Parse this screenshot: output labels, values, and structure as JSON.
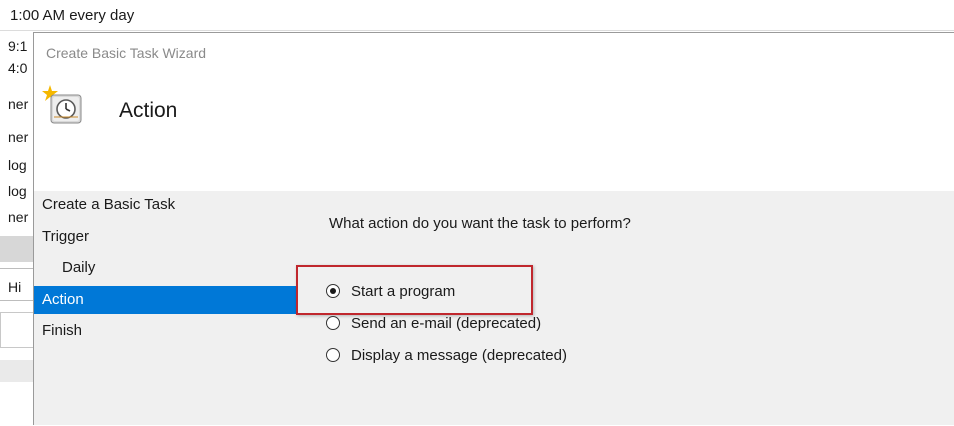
{
  "background": {
    "top_text": "1:00 AM every day",
    "rows": [
      "9:1",
      "4:0",
      "ner",
      "ner",
      "log",
      "log",
      "ner",
      "",
      "",
      "Hi"
    ]
  },
  "dialog": {
    "title": "Create Basic Task Wizard",
    "heading": "Action",
    "icon": "task-clock-icon",
    "nav": [
      {
        "label": "Create a Basic Task",
        "selected": false
      },
      {
        "label": "Trigger",
        "selected": false
      },
      {
        "label": "Daily",
        "selected": false
      },
      {
        "label": "Action",
        "selected": true
      },
      {
        "label": "Finish",
        "selected": false
      }
    ],
    "question": "What action do you want the task to perform?",
    "options": [
      {
        "label": "Start a program",
        "checked": true
      },
      {
        "label": "Send an e-mail (deprecated)",
        "checked": false
      },
      {
        "label": "Display a message (deprecated)",
        "checked": false
      }
    ],
    "colors": {
      "selected_bg": "#0078d7",
      "highlight_border": "#c0272d"
    }
  }
}
